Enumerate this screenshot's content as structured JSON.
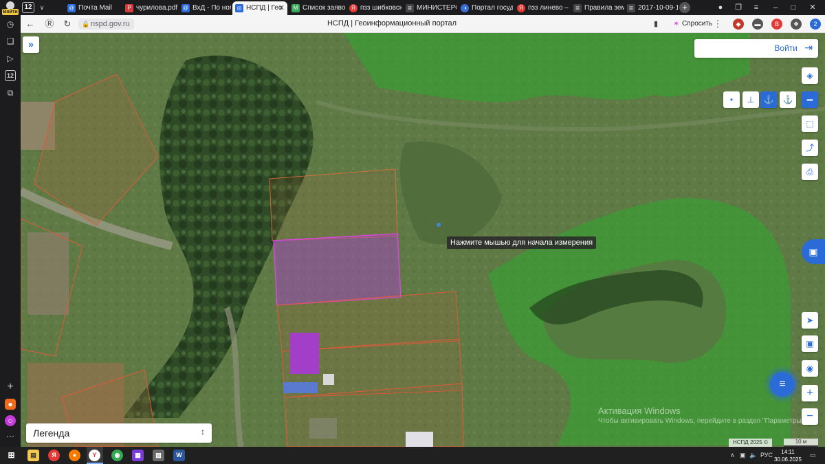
{
  "browser": {
    "tab_count": "12",
    "tabs": [
      {
        "label": "Почта Mail",
        "icon": "mail-icon",
        "color": "#2a6bd8"
      },
      {
        "label": "чурилова.pdf",
        "icon": "pdf-icon",
        "color": "#d83b3b"
      },
      {
        "label": "ВхД - По номе",
        "icon": "mail-icon",
        "color": "#2a6bd8"
      },
      {
        "label": "НСПД | Гео",
        "icon": "globe-icon",
        "color": "#2a6bd8",
        "active": true
      },
      {
        "label": "Список заявок",
        "icon": "m-icon",
        "color": "#3aa65a"
      },
      {
        "label": "пзз шибковск",
        "icon": "yandex-icon",
        "color": "#e53935"
      },
      {
        "label": "МИНИСТЕРС",
        "icon": "doc-icon",
        "color": "#444"
      },
      {
        "label": "Портал госуд",
        "icon": "flag-icon",
        "color": "#3a6fd8"
      },
      {
        "label": "пзз линево –",
        "icon": "yandex-icon",
        "color": "#e53935"
      },
      {
        "label": "Правила зем",
        "icon": "doc-icon",
        "color": "#444"
      },
      {
        "label": "2017-10-09-1",
        "icon": "doc-icon",
        "color": "#444"
      }
    ],
    "url": "nspd.gov.ru",
    "page_title": "НСПД | Геоинформационный портал",
    "ask_label": "Спросить",
    "login_badge": "Войти",
    "ext_badge": "2"
  },
  "map": {
    "login_label": "Войти",
    "measure_tip": "Нажмите мышью для начала измерения",
    "legend_label": "Легенда",
    "watermark_title": "Активация Windows",
    "watermark_sub": "Чтобы активировать Windows, перейдите в раздел \"Параметры\".",
    "copyright": "НСПД 2025 ©",
    "scale_label": "10 м",
    "zoom_in": "+",
    "zoom_out": "−"
  },
  "taskbar": {
    "lang": "РУС",
    "time": "14:11",
    "date": "30.06.2025"
  },
  "colors": {
    "accent": "#2a6bd8",
    "selected_parcel": "#b03bd0",
    "forest_zone": "#2ea82e",
    "parcel_border": "#e05a3a"
  }
}
